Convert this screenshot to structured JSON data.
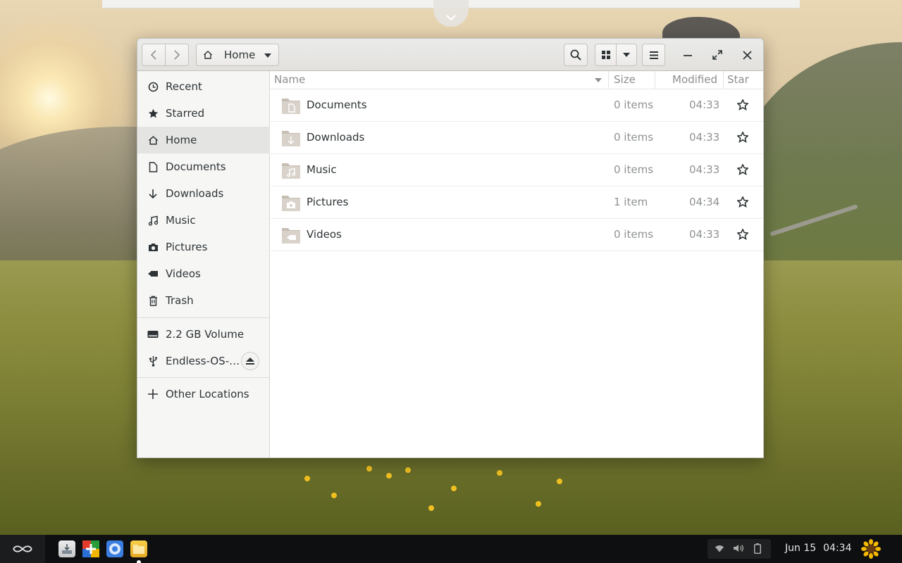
{
  "window": {
    "location_label": "Home",
    "colors": {
      "accent": "#3584e4",
      "headerbar": "#e5e4e1",
      "sidebar_active": "#e4e4e2"
    }
  },
  "sidebar": {
    "places": [
      {
        "label": "Recent",
        "icon": "clock-icon"
      },
      {
        "label": "Starred",
        "icon": "star-icon"
      },
      {
        "label": "Home",
        "icon": "home-icon",
        "active": true
      },
      {
        "label": "Documents",
        "icon": "document-icon"
      },
      {
        "label": "Downloads",
        "icon": "download-icon"
      },
      {
        "label": "Music",
        "icon": "music-icon"
      },
      {
        "label": "Pictures",
        "icon": "camera-icon"
      },
      {
        "label": "Videos",
        "icon": "video-icon"
      },
      {
        "label": "Trash",
        "icon": "trash-icon"
      }
    ],
    "devices": [
      {
        "label": "2.2 GB Volume",
        "icon": "drive-icon"
      },
      {
        "label": "Endless-OS-…",
        "icon": "usb-icon",
        "ejectable": true
      }
    ],
    "other": {
      "label": "Other Locations",
      "icon": "plus-icon"
    }
  },
  "columns": {
    "name": "Name",
    "size": "Size",
    "modified": "Modified",
    "star": "Star"
  },
  "files": [
    {
      "name": "Documents",
      "size": "0 items",
      "modified": "04:33",
      "icon": "folder-documents-icon"
    },
    {
      "name": "Downloads",
      "size": "0 items",
      "modified": "04:33",
      "icon": "folder-download-icon"
    },
    {
      "name": "Music",
      "size": "0 items",
      "modified": "04:33",
      "icon": "folder-music-icon"
    },
    {
      "name": "Pictures",
      "size": "1 item",
      "modified": "04:34",
      "icon": "folder-pictures-icon"
    },
    {
      "name": "Videos",
      "size": "0 items",
      "modified": "04:33",
      "icon": "folder-videos-icon"
    }
  ],
  "taskbar": {
    "date": "Jun 15",
    "time": "04:34"
  }
}
